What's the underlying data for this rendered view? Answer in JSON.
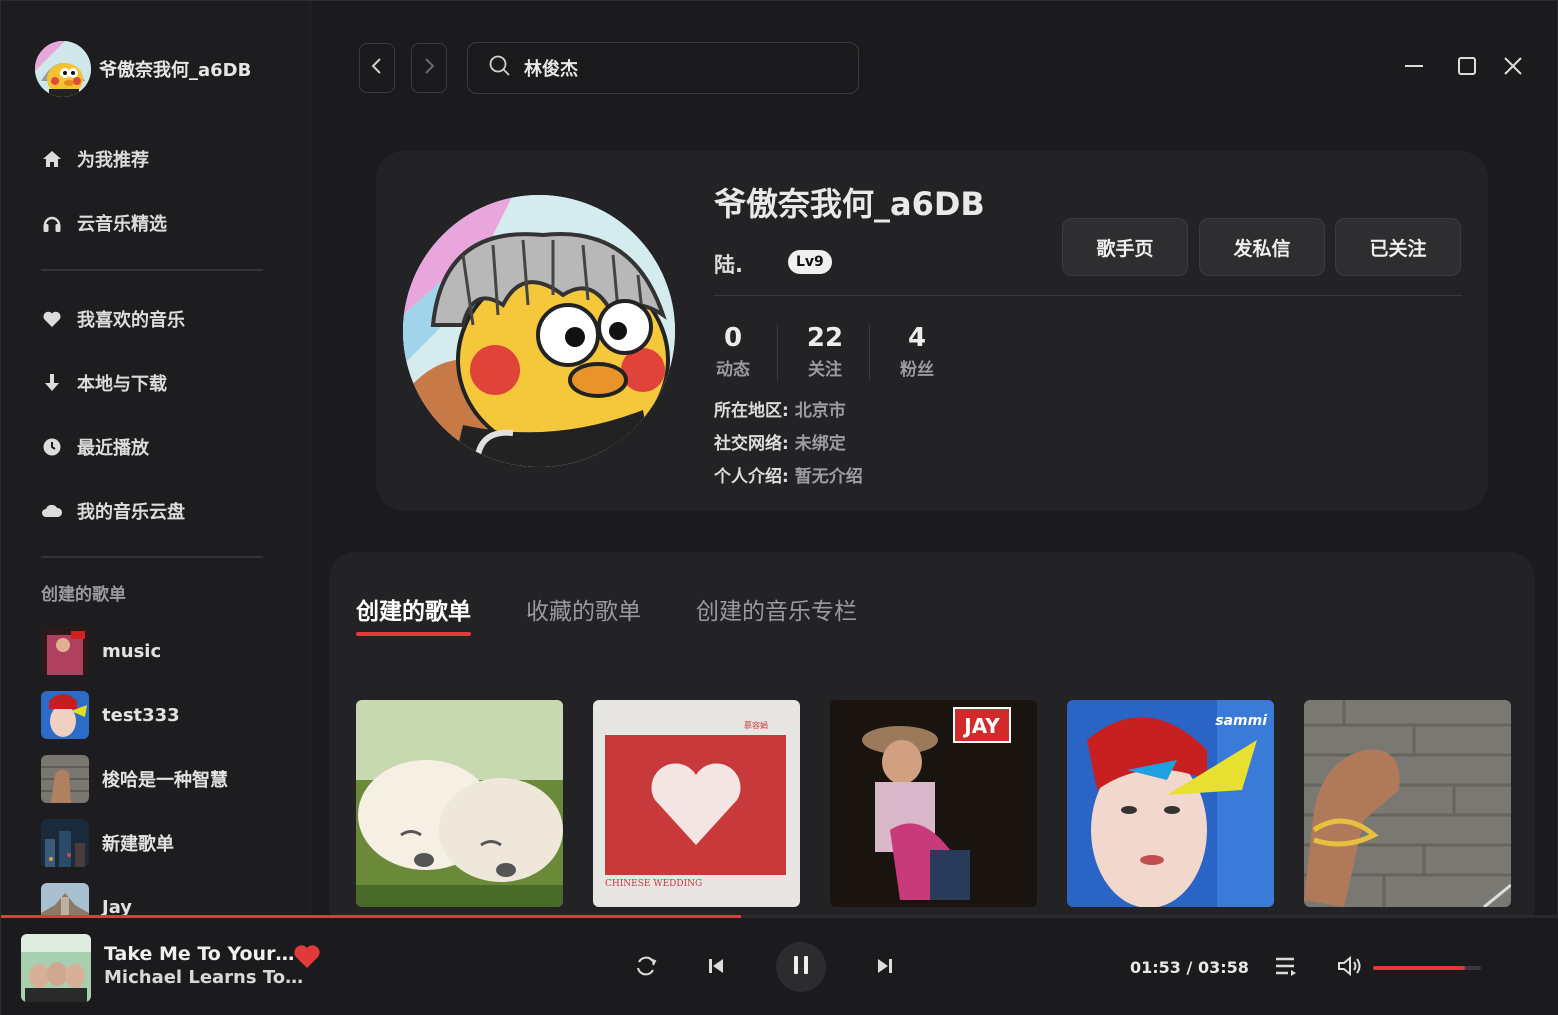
{
  "user": {
    "name": "爷傲奈我何_a6DB"
  },
  "nav": [
    {
      "label": "为我推荐",
      "icon": "home-icon"
    },
    {
      "label": "云音乐精选",
      "icon": "headphones-icon"
    }
  ],
  "nav2": [
    {
      "label": "我喜欢的音乐",
      "icon": "heart-icon"
    },
    {
      "label": "本地与下载",
      "icon": "download-icon"
    },
    {
      "label": "最近播放",
      "icon": "clock-icon"
    },
    {
      "label": "我的音乐云盘",
      "icon": "cloud-icon"
    }
  ],
  "sidebar": {
    "section_title": "创建的歌单",
    "playlists": [
      {
        "name": "music"
      },
      {
        "name": "test333"
      },
      {
        "name": "梭哈是一种智慧"
      },
      {
        "name": "新建歌单"
      },
      {
        "name": "Jay"
      }
    ]
  },
  "search": {
    "value": "林俊杰"
  },
  "profile": {
    "name": "爷傲奈我何_a6DB",
    "nickname": "陆.",
    "level": "Lv9",
    "buttons": {
      "artist": "歌手页",
      "message": "发私信",
      "follow": "已关注"
    },
    "stats": [
      {
        "num": "0",
        "label": "动态"
      },
      {
        "num": "22",
        "label": "关注"
      },
      {
        "num": "4",
        "label": "粉丝"
      }
    ],
    "info": [
      {
        "key": "所在地区: ",
        "val": "北京市"
      },
      {
        "key": "社交网络: ",
        "val": "未绑定"
      },
      {
        "key": "个人介绍: ",
        "val": "暂无介绍"
      }
    ]
  },
  "tabs": [
    {
      "label": "创建的歌单",
      "active": true
    },
    {
      "label": "收藏的歌单",
      "active": false
    },
    {
      "label": "创建的音乐专栏",
      "active": false
    }
  ],
  "player": {
    "title": "Take Me To Your…",
    "artist": "Michael Learns To…",
    "time_current": "01:53",
    "time_sep": "/",
    "time_total": "03:58",
    "progress": 0.475,
    "volume": 0.85
  },
  "colors": {
    "accent": "#e23a3a",
    "background": "#1b1b1d",
    "card": "#232326"
  }
}
